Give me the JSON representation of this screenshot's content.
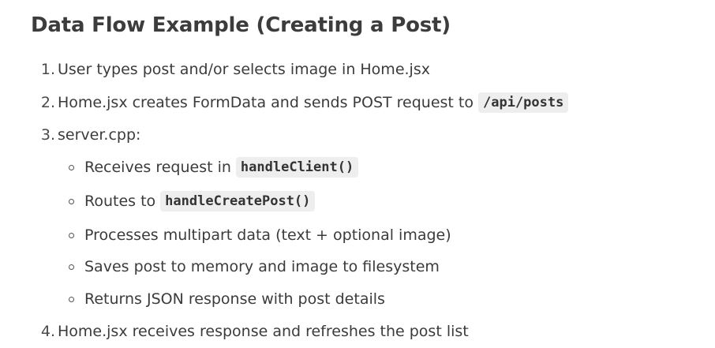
{
  "heading": "Data Flow Example (Creating a Post)",
  "steps": [
    {
      "number": "1.",
      "text": "User types post and/or selects image in Home.jsx"
    },
    {
      "number": "2.",
      "text": "Home.jsx creates FormData and sends POST request to",
      "code": "/api/posts"
    },
    {
      "number": "3.",
      "text": "server.cpp:"
    },
    {
      "number": "4.",
      "text": "Home.jsx receives response and refreshes the post list"
    }
  ],
  "substeps": [
    {
      "text": "Receives request in",
      "code": "handleClient()"
    },
    {
      "text": "Routes to",
      "code": "handleCreatePost()"
    },
    {
      "text": "Processes multipart data (text + optional image)"
    },
    {
      "text": "Saves post to memory and image to filesystem"
    },
    {
      "text": "Returns JSON response with post details"
    }
  ]
}
